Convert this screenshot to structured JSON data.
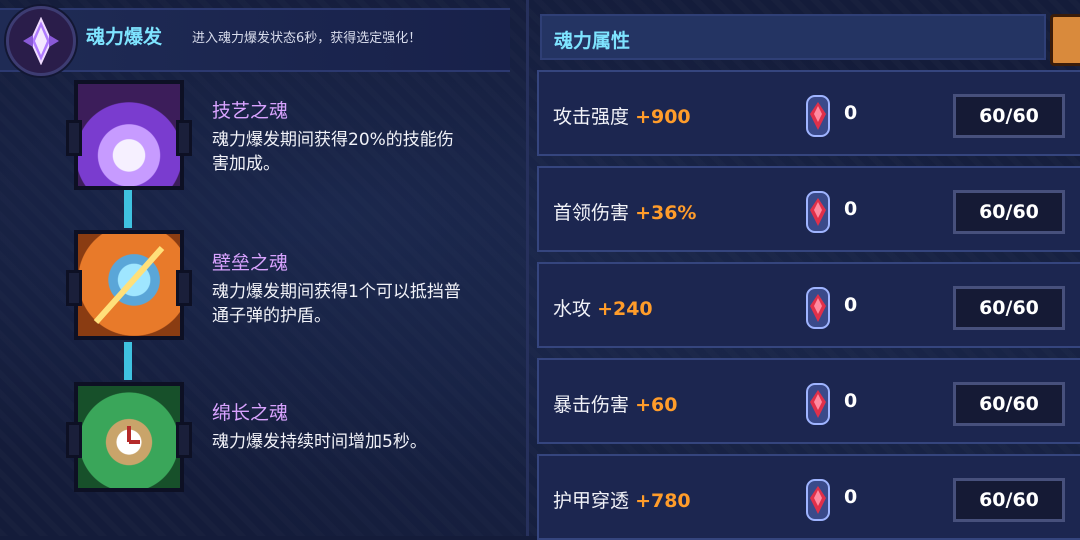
{
  "soul_burst": {
    "title": "魂力爆发",
    "description": "进入魂力爆发状态6秒，获得选定强化！"
  },
  "skills": [
    {
      "name": "技艺之魂",
      "desc_line1": "魂力爆发期间获得20%的技能伤",
      "desc_line2": "害加成。",
      "icon": "purple-flame-icon"
    },
    {
      "name": "壁垒之魂",
      "desc_line1": "魂力爆发期间获得1个可以抵挡普",
      "desc_line2": "通子弹的护盾。",
      "icon": "shield-sword-icon"
    },
    {
      "name": "绵长之魂",
      "desc_line1": "魂力爆发持续时间增加5秒。",
      "desc_line2": "",
      "icon": "stopwatch-icon"
    }
  ],
  "attributes_panel": {
    "title": "魂力属性",
    "rows": [
      {
        "name": "攻击强度",
        "bonus": "+900",
        "gem_count": "0",
        "cap": "60/60"
      },
      {
        "name": "首领伤害",
        "bonus": "+36%",
        "gem_count": "0",
        "cap": "60/60"
      },
      {
        "name": "水攻",
        "bonus": "+240",
        "gem_count": "0",
        "cap": "60/60"
      },
      {
        "name": "暴击伤害",
        "bonus": "+60",
        "gem_count": "0",
        "cap": "60/60"
      },
      {
        "name": "护甲穿透",
        "bonus": "+780",
        "gem_count": "0",
        "cap": "60/60"
      }
    ]
  },
  "colors": {
    "accent_cyan": "#7ee4ff",
    "bonus_orange": "#ff9c2a",
    "skill_purple": "#d9a3ff"
  }
}
